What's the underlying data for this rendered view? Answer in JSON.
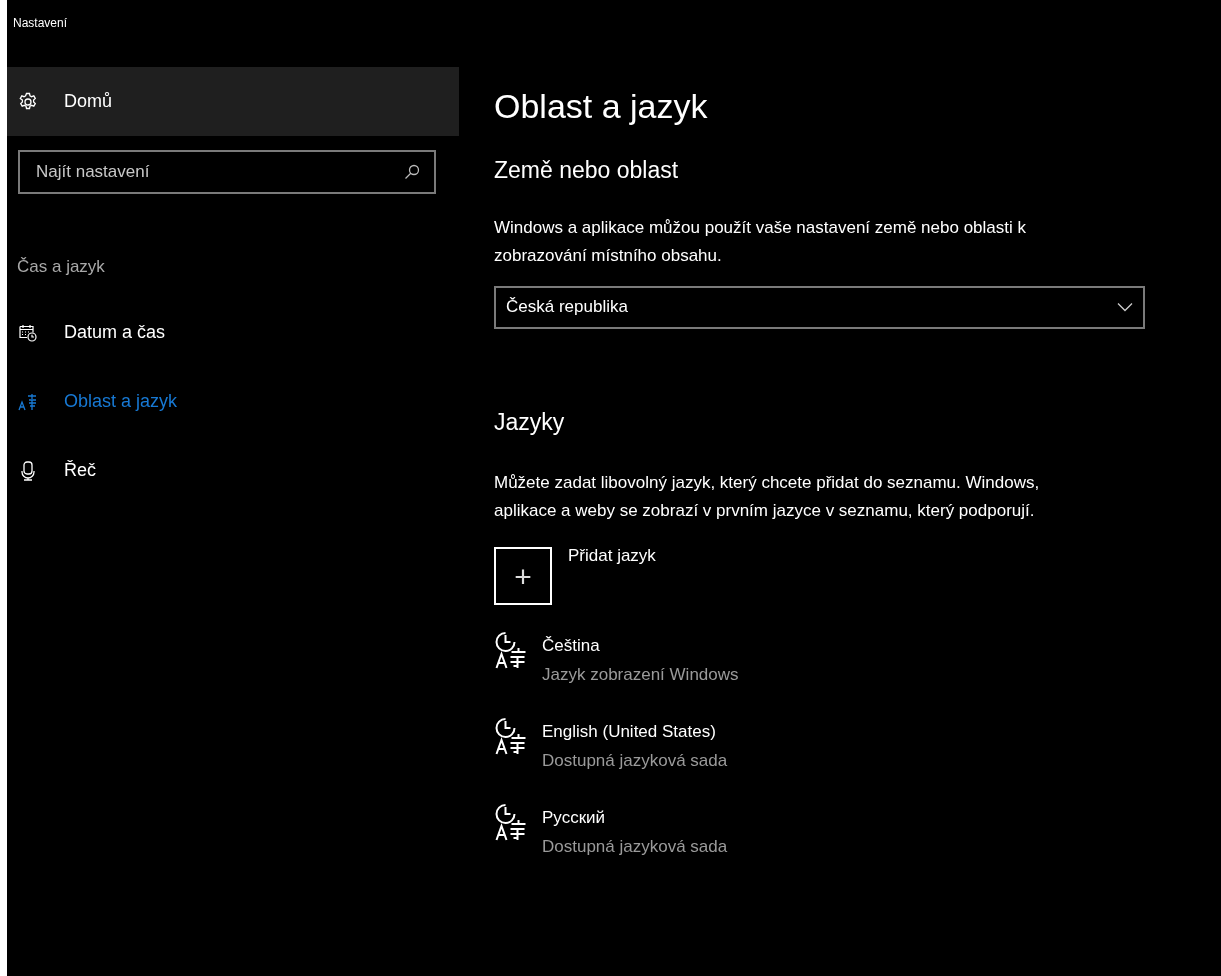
{
  "window": {
    "title": "Nastavení"
  },
  "sidebar": {
    "home": {
      "label": "Domů"
    },
    "search": {
      "placeholder": "Najít nastavení"
    },
    "section": "Čas a jazyk",
    "items": [
      {
        "label": "Datum a čas",
        "kind": "calendar",
        "selected": false
      },
      {
        "label": "Oblast a jazyk",
        "kind": "language",
        "selected": true
      },
      {
        "label": "Řeč",
        "kind": "microphone",
        "selected": false
      }
    ]
  },
  "main": {
    "title": "Oblast a jazyk",
    "region": {
      "heading": "Země nebo oblast",
      "description": "Windows a aplikace můžou použít vaše nastavení země nebo oblasti k zobrazování místního obsahu.",
      "dropdown": "Česká republika"
    },
    "languages": {
      "heading": "Jazyky",
      "description": "Můžete zadat libovolný jazyk, který chcete přidat do seznamu. Windows, aplikace a weby se zobrazí v prvním jazyce v seznamu, který podporují.",
      "add_button": {
        "icon": "+",
        "label": "Přidat jazyk"
      },
      "items": [
        {
          "name": "Čeština",
          "status": "Jazyk zobrazení Windows"
        },
        {
          "name": "English (United States)",
          "status": "Dostupná jazyková sada"
        },
        {
          "name": "Русский",
          "status": "Dostupná jazyková sada"
        }
      ]
    }
  }
}
